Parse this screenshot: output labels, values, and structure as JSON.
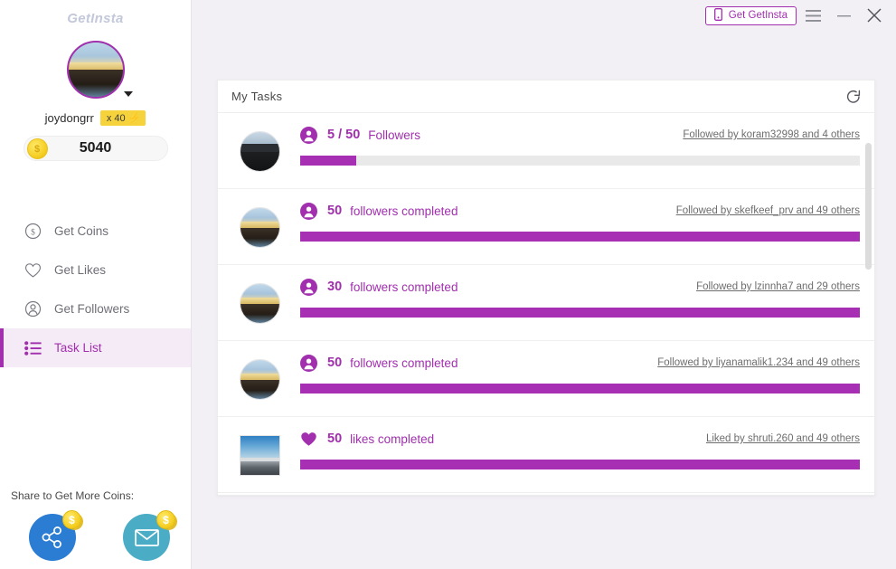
{
  "app": {
    "logo": "GetInsta"
  },
  "titlebar": {
    "get_app_label": "Get GetInsta",
    "phone_icon": "phone-icon",
    "menu_icon": "hamburger-menu-icon",
    "minimize_icon": "minimize-icon",
    "close_icon": "close-icon"
  },
  "profile": {
    "username": "joydongrr",
    "multiplier": "x 40",
    "bolt": "⚡",
    "coins": "5040",
    "coin_symbol": "$"
  },
  "sidebar": {
    "items": [
      {
        "label": "Get Coins",
        "icon": "coin-dollar-icon",
        "active": false
      },
      {
        "label": "Get Likes",
        "icon": "heart-icon",
        "active": false
      },
      {
        "label": "Get Followers",
        "icon": "user-circle-icon",
        "active": false
      },
      {
        "label": "Task List",
        "icon": "list-icon",
        "active": true
      }
    ],
    "share_label": "Share to Get More Coins:",
    "share_buttons": [
      {
        "name": "share-network-button",
        "icon": "share-nodes-icon",
        "color": "#2b7cd3",
        "badge": "$"
      },
      {
        "name": "share-email-button",
        "icon": "envelope-icon",
        "color": "#4bacc6",
        "badge": "$"
      }
    ]
  },
  "panel": {
    "title": "My Tasks",
    "refresh_icon": "refresh-icon",
    "accent_color": "#a12fae",
    "bar_color": "#a72fb4",
    "track_color": "#e9e9e9",
    "tasks": [
      {
        "type": "followers",
        "icon": "user-circle-icon",
        "count": "5 / 50",
        "label": "Followers",
        "meta": "Followed by koram32998 and 4 others",
        "progress": 10,
        "thumb": "dark",
        "thumb_shape": "round"
      },
      {
        "type": "followers",
        "icon": "user-circle-icon",
        "count": "50",
        "label": "followers completed",
        "meta": "Followed by skefkeef_prv and 49 others",
        "progress": 100,
        "thumb": "landscape",
        "thumb_shape": "round"
      },
      {
        "type": "followers",
        "icon": "user-circle-icon",
        "count": "30",
        "label": "followers completed",
        "meta": "Followed by lzinnha7 and 29 others",
        "progress": 100,
        "thumb": "landscape",
        "thumb_shape": "round"
      },
      {
        "type": "followers",
        "icon": "user-circle-icon",
        "count": "50",
        "label": "followers completed",
        "meta": "Followed by liyanamalik1.234 and 49 others",
        "progress": 100,
        "thumb": "landscape",
        "thumb_shape": "round"
      },
      {
        "type": "likes",
        "icon": "heart-icon",
        "count": "50",
        "label": "likes completed",
        "meta": "Liked by shruti.260 and 49 others",
        "progress": 100,
        "thumb": "beach",
        "thumb_shape": "square"
      }
    ]
  }
}
